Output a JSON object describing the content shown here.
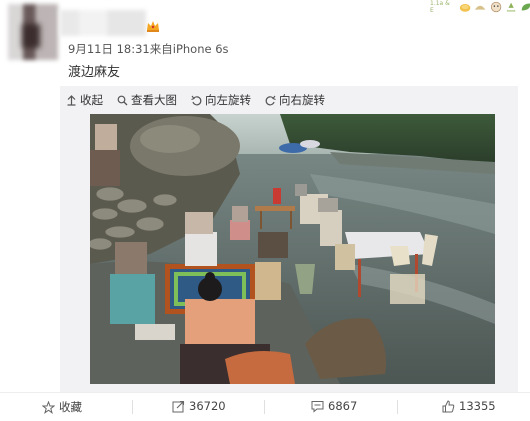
{
  "post": {
    "timestamp": "9月11日 18:31",
    "source": "来自iPhone 6s",
    "text": "渡边麻友",
    "corner_text": "1.1a & E"
  },
  "toolbar": {
    "collapse": "收起",
    "view_large": "查看大图",
    "rotate_left": "向左旋转",
    "rotate_right": "向右旋转"
  },
  "footer": {
    "favorite": "收藏",
    "repost_count": "36720",
    "comment_count": "6867",
    "like_count": "13355"
  },
  "icons": {
    "badge": "crown-icon",
    "collapse": "arrow-up-icon",
    "view_large": "magnifier-icon",
    "rotate_left": "rotate-left-icon",
    "rotate_right": "rotate-right-icon",
    "favorite": "star-icon",
    "repost": "share-icon",
    "comment": "comment-icon",
    "like": "thumb-up-icon"
  },
  "colors": {
    "accent": "#f5a623",
    "text": "#333333",
    "media_bg": "#f2f2f5"
  }
}
